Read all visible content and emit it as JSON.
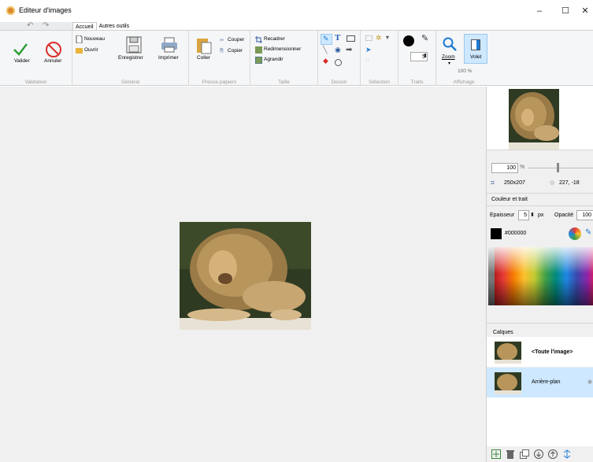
{
  "window": {
    "title": "Editeur d'images",
    "minimize": "–",
    "maximize": "☐",
    "close": "✕"
  },
  "quick_access": {
    "undo": "↶",
    "redo": "↷"
  },
  "tabs": [
    {
      "label": "Accueil"
    },
    {
      "label": "Autres outils"
    }
  ],
  "ribbon": {
    "validation": {
      "label": "Validation",
      "ok": "Valider",
      "cancel": "Annuler"
    },
    "general": {
      "label": "Général",
      "new": "Nouveau",
      "open": "Ouvrir",
      "save": "Enregistrer",
      "print": "Imprimer"
    },
    "clipboard": {
      "label": "Presse-papiers",
      "paste": "Coller",
      "cut": "Couper",
      "copy": "Copier"
    },
    "size": {
      "label": "Taille",
      "crop": "Recadrer",
      "resize": "Redimensionner",
      "enlarge": "Agrandir"
    },
    "draw": {
      "label": "Dessin"
    },
    "selection": {
      "label": "Sélection"
    },
    "strokes": {
      "label": "Traits",
      "width": "5"
    },
    "display": {
      "label": "Affichage",
      "zoom": "Zoom",
      "panel": "Volet",
      "zoom_value": "100 %"
    }
  },
  "panel": {
    "zoom_value": "100",
    "zoom_unit": "%",
    "zoom_level": 0.5,
    "size_text": "250x207",
    "coords_text": "227, -18",
    "color_section": "Couleur et trait",
    "thickness_label": "Epaisseur",
    "thickness_value": "5",
    "thickness_unit": "px",
    "opacity_label": "Opacité",
    "opacity_value": "100",
    "color_hex": "#000000",
    "layers_title": "Calques",
    "layers": [
      {
        "name": "<Toute l'image>"
      },
      {
        "name": "Arrière-plan"
      }
    ]
  },
  "colors": {
    "accent": "#1e7bd6",
    "selected_layer": "#cde8ff",
    "valid_green": "#2f9e3a",
    "cancel_red": "#d9302c"
  }
}
